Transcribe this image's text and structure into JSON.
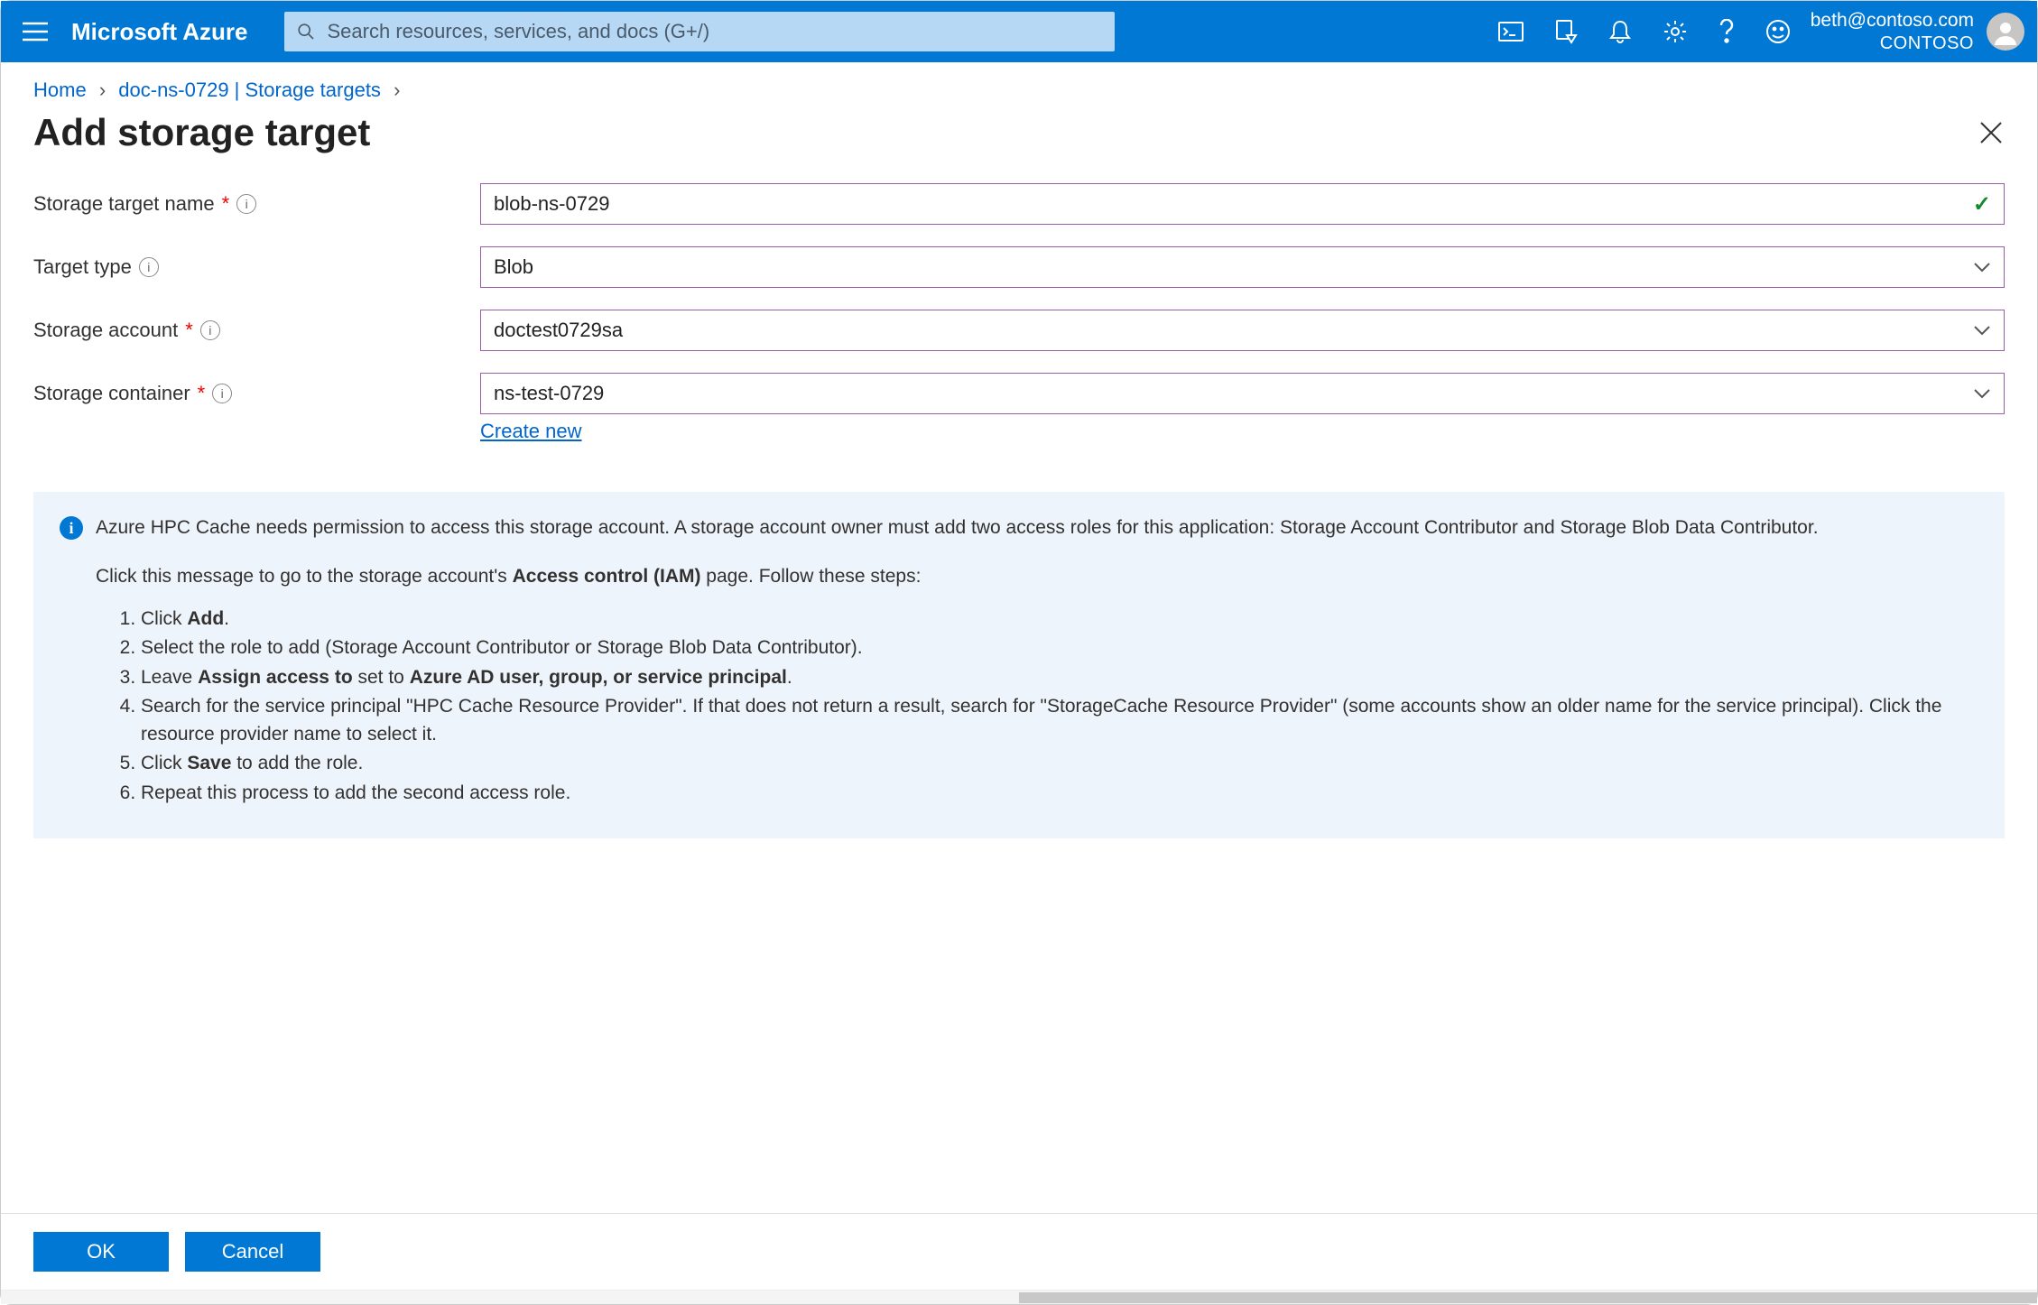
{
  "header": {
    "brand": "Microsoft Azure",
    "search_placeholder": "Search resources, services, and docs (G+/)",
    "account_email": "beth@contoso.com",
    "account_tenant": "CONTOSO"
  },
  "breadcrumb": {
    "home": "Home",
    "resource": "doc-ns-0729 | Storage targets"
  },
  "page": {
    "title": "Add storage target"
  },
  "form": {
    "storage_target_name": {
      "label": "Storage target name",
      "value": "blob-ns-0729",
      "required": true
    },
    "target_type": {
      "label": "Target type",
      "value": "Blob",
      "required": false
    },
    "storage_account": {
      "label": "Storage account",
      "value": "doctest0729sa",
      "required": true
    },
    "storage_container": {
      "label": "Storage container",
      "value": "ns-test-0729",
      "required": true,
      "create_new_label": "Create new"
    }
  },
  "info": {
    "intro": "Azure HPC Cache needs permission to access this storage account. A storage account owner must add two access roles for this application: Storage Account Contributor and Storage Blob Data Contributor.",
    "iam_line_pre": "Click this message to go to the storage account's ",
    "iam_bold": "Access control (IAM)",
    "iam_line_post": " page. Follow these steps:",
    "steps": {
      "s1_pre": "Click ",
      "s1_b": "Add",
      "s1_post": ".",
      "s2": "Select the role to add (Storage Account Contributor or Storage Blob Data Contributor).",
      "s3_pre": "Leave ",
      "s3_b1": "Assign access to",
      "s3_mid": " set to ",
      "s3_b2": "Azure AD user, group, or service principal",
      "s3_post": ".",
      "s4": "Search for the service principal \"HPC Cache Resource Provider\". If that does not return a result, search for \"StorageCache Resource Provider\" (some accounts show an older name for the service principal). Click the resource provider name to select it.",
      "s5_pre": "Click ",
      "s5_b": "Save",
      "s5_post": " to add the role.",
      "s6": "Repeat this process to add the second access role."
    }
  },
  "footer": {
    "ok": "OK",
    "cancel": "Cancel"
  }
}
